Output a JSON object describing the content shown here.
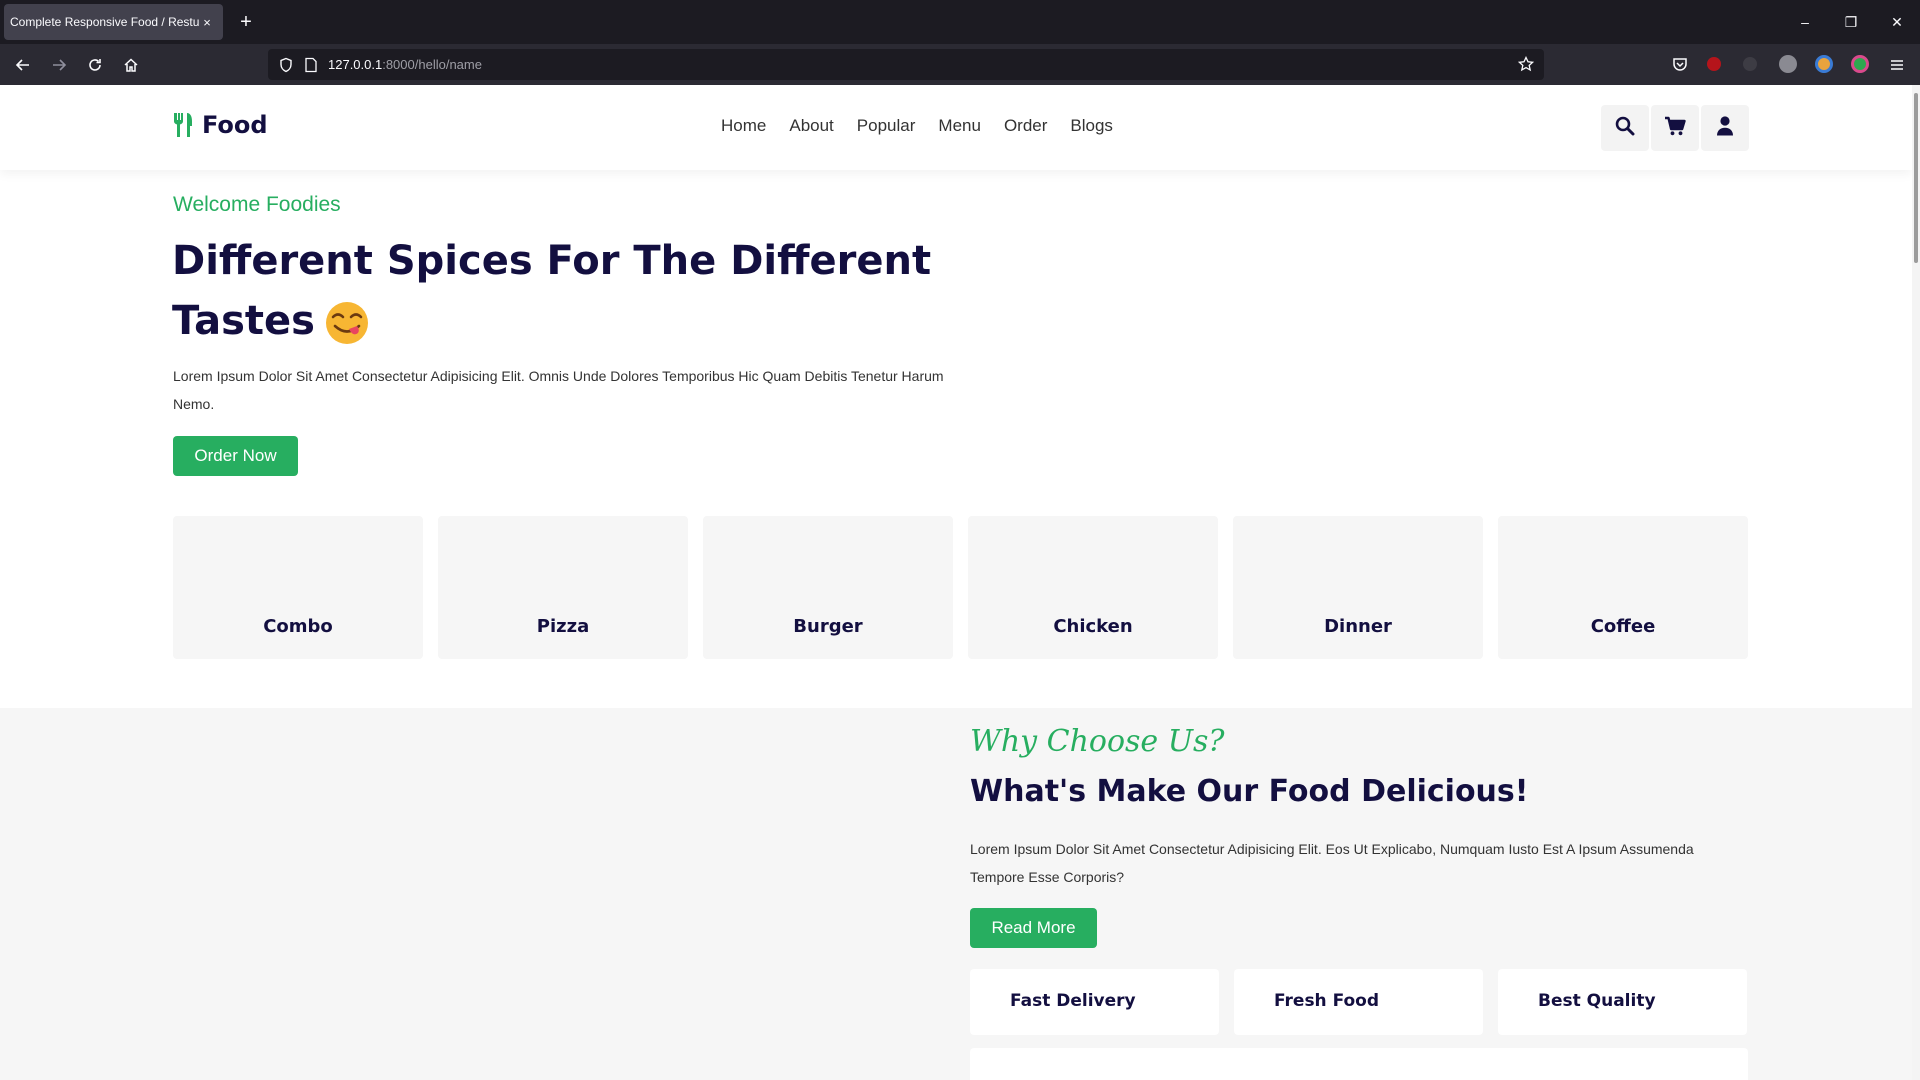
{
  "browser": {
    "tab_title": "Complete Responsive Food / Restur",
    "tab_close": "×",
    "new_tab": "+",
    "url_host": "127.0.0.1",
    "url_path": ":8000/hello/name",
    "window_controls": [
      "–",
      "❐",
      "✕"
    ]
  },
  "site": {
    "logo": "Food",
    "nav": [
      "Home",
      "About",
      "Popular",
      "Menu",
      "Order",
      "Blogs"
    ],
    "header_icons": [
      "search-icon",
      "cart-icon",
      "user-icon"
    ]
  },
  "hero": {
    "welcome": "Welcome Foodies",
    "title": "Different Spices For The Different Tastes",
    "text": "Lorem Ipsum Dolor Sit Amet Consectetur Adipisicing Elit. Omnis Unde Dolores Temporibus Hic Quam Debitis Tenetur Harum Nemo.",
    "cta": "Order Now"
  },
  "categories": [
    "Combo",
    "Pizza",
    "Burger",
    "Chicken",
    "Dinner",
    "Coffee"
  ],
  "why": {
    "subtitle": "Why Choose Us?",
    "title": "What's Make Our Food Delicious!",
    "text": "Lorem Ipsum Dolor Sit Amet Consectetur Adipisicing Elit. Eos Ut Explicabo, Numquam Iusto Est A Ipsum Assumenda Tempore Esse Corporis?",
    "cta": "Read More",
    "features": [
      "Fast Delivery",
      "Fresh Food",
      "Best Quality"
    ]
  },
  "colors": {
    "accent": "#27ae60",
    "heading": "#130f40"
  }
}
